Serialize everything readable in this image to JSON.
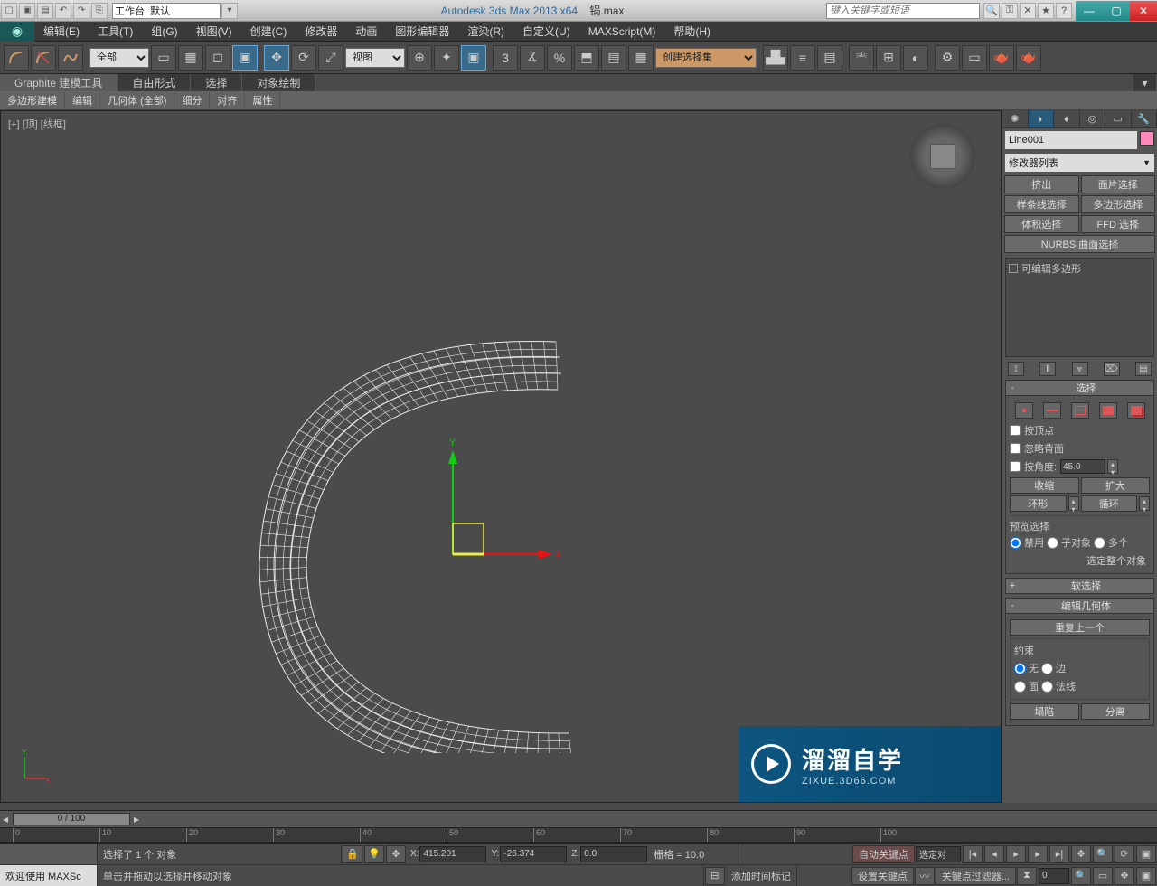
{
  "titlebar": {
    "workspace_label": "工作台: 默认",
    "app_title": "Autodesk 3ds Max  2013 x64",
    "file_name": "锅.max",
    "search_placeholder": "键入关键字或短语"
  },
  "menu": {
    "items": [
      "编辑(E)",
      "工具(T)",
      "组(G)",
      "视图(V)",
      "创建(C)",
      "修改器",
      "动画",
      "图形编辑器",
      "渲染(R)",
      "自定义(U)",
      "MAXScript(M)",
      "帮助(H)"
    ]
  },
  "toolbar": {
    "filter_dd": "全部",
    "view_dd": "视图",
    "named_sel": "创建选择集"
  },
  "ribbon": {
    "tabs": [
      "Graphite 建模工具",
      "自由形式",
      "选择",
      "对象绘制"
    ],
    "sub": [
      "多边形建模",
      "编辑",
      "几何体 (全部)",
      "细分",
      "对齐",
      "属性"
    ]
  },
  "viewport": {
    "label": "[+] [顶] [线框]",
    "axis": {
      "x": "x",
      "y": "Y"
    }
  },
  "watermark": {
    "line1": "溜溜自学",
    "line2": "ZIXUE.3D66.COM"
  },
  "right": {
    "object_name": "Line001",
    "modifier_list": "修改器列表",
    "preset_buttons": [
      "挤出",
      "面片选择",
      "样条线选择",
      "多边形选择",
      "体积选择",
      "FFD 选择"
    ],
    "nurbs": "NURBS 曲面选择",
    "stack_item": "可编辑多边形",
    "rollouts": {
      "selection": {
        "title": "选择",
        "pm": "-",
        "by_vertex": "按顶点",
        "ignore_backface": "忽略背面",
        "by_angle": "按角度:",
        "angle_value": "45.0",
        "shrink": "收缩",
        "grow": "扩大",
        "ring": "环形",
        "loop": "循环",
        "preview_label": "预览选择",
        "disable": "禁用",
        "subobj": "子对象",
        "multi": "多个",
        "select_whole": "选定整个对象"
      },
      "soft": {
        "title": "软选择",
        "pm": "+"
      },
      "edit_geom": {
        "title": "编辑几何体",
        "pm": "-",
        "repeat": "重复上一个"
      },
      "constraint": {
        "label": "约束",
        "none": "无",
        "edge": "边",
        "face": "面",
        "normal": "法线"
      },
      "extra": {
        "collapse": "塌陷",
        "detach": "分离"
      }
    }
  },
  "timeline": {
    "slider": "0 / 100",
    "ticks": [
      "0",
      "10",
      "20",
      "30",
      "40",
      "50",
      "60",
      "70",
      "80",
      "90",
      "100"
    ]
  },
  "status": {
    "selected": "选择了 1 个 对象",
    "x": "415.201",
    "y": "-26.374",
    "z": "0.0",
    "grid": "栅格 = 10.0",
    "auto_key": "自动关键点",
    "set_key": "设置关键点",
    "key_filter": "关键点过滤器...",
    "sel_set": "选定对",
    "add_time": "添加时间标记",
    "welcome": "欢迎使用 MAXSc",
    "dragmove": "单击并拖动以选择并移动对象"
  }
}
